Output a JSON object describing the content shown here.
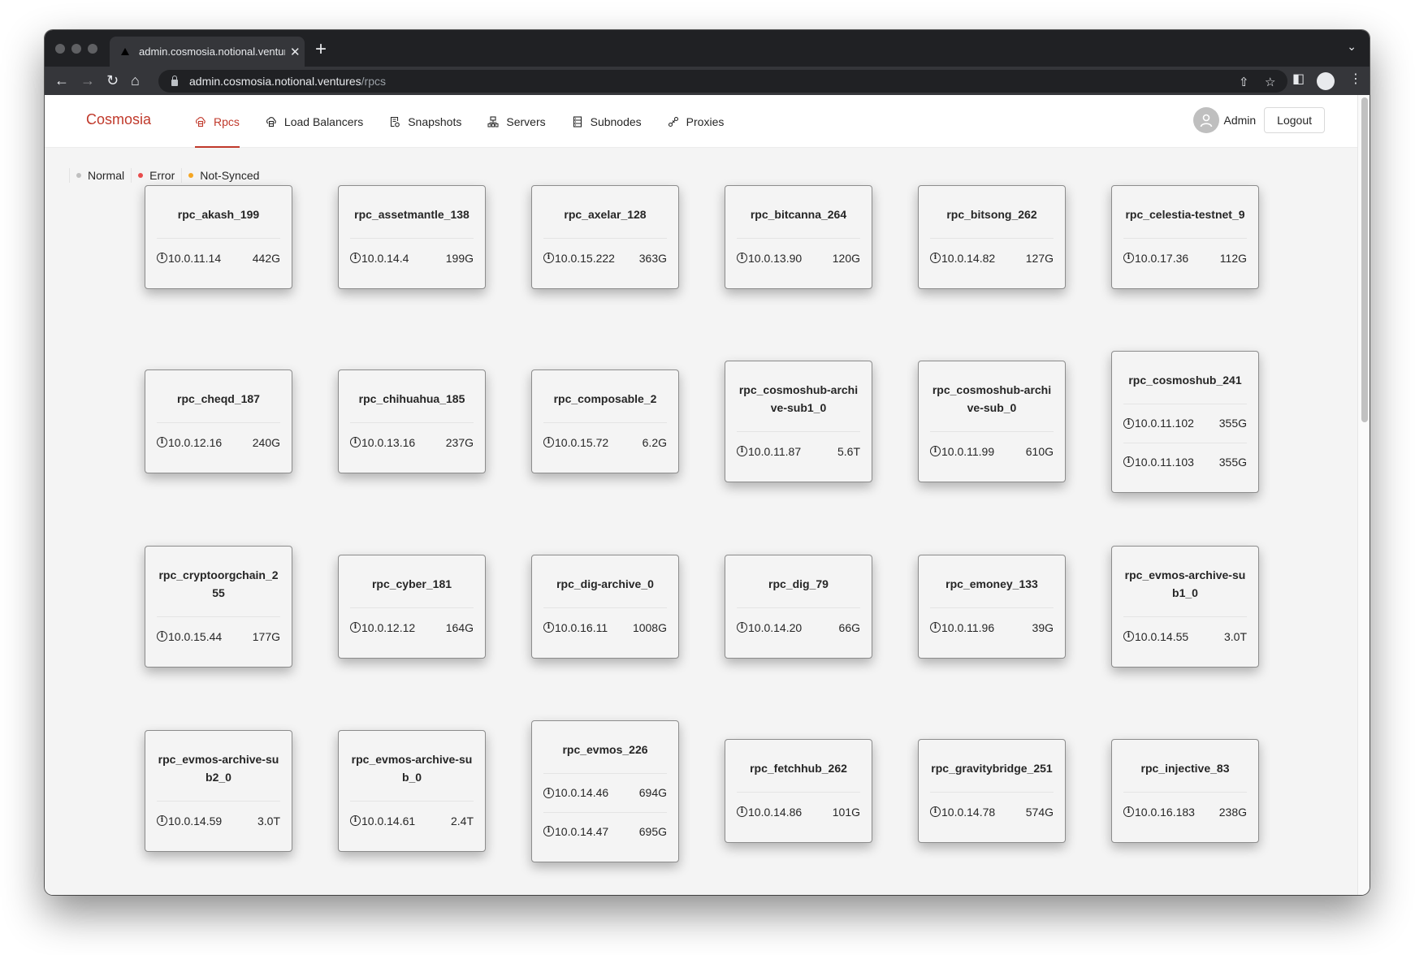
{
  "browser": {
    "tab_title": "admin.cosmosia.notional.ventures",
    "new_tab_label": "+",
    "url_host": "admin.cosmosia.notional.ventures",
    "url_path": "/rpcs"
  },
  "header": {
    "brand": "Cosmosia",
    "nav": [
      {
        "label": "Rpcs",
        "icon": "cloud-server-icon",
        "active": true
      },
      {
        "label": "Load Balancers",
        "icon": "cloud-server-icon",
        "active": false
      },
      {
        "label": "Snapshots",
        "icon": "file-sync-icon",
        "active": false
      },
      {
        "label": "Servers",
        "icon": "cluster-icon",
        "active": false
      },
      {
        "label": "Subnodes",
        "icon": "database-icon",
        "active": false
      },
      {
        "label": "Proxies",
        "icon": "link-icon",
        "active": false
      }
    ],
    "user_name": "Admin",
    "logout_label": "Logout"
  },
  "colors": {
    "accent": "#c0392b",
    "normal": "#bfbfbf",
    "error": "#e84c4c",
    "not_synced": "#f5a623"
  },
  "legend": [
    {
      "label": "Normal",
      "status": "normal"
    },
    {
      "label": "Error",
      "status": "error"
    },
    {
      "label": "Not-Synced",
      "status": "not_synced"
    }
  ],
  "rpcs": [
    {
      "name": "rpc_akash_199",
      "nodes": [
        {
          "ip": "10.0.11.14",
          "size": "442G"
        }
      ]
    },
    {
      "name": "rpc_assetmantle_138",
      "nodes": [
        {
          "ip": "10.0.14.4",
          "size": "199G"
        }
      ]
    },
    {
      "name": "rpc_axelar_128",
      "nodes": [
        {
          "ip": "10.0.15.222",
          "size": "363G"
        }
      ]
    },
    {
      "name": "rpc_bitcanna_264",
      "nodes": [
        {
          "ip": "10.0.13.90",
          "size": "120G"
        }
      ]
    },
    {
      "name": "rpc_bitsong_262",
      "nodes": [
        {
          "ip": "10.0.14.82",
          "size": "127G"
        }
      ]
    },
    {
      "name": "rpc_celestia-testnet_9",
      "nodes": [
        {
          "ip": "10.0.17.36",
          "size": "112G"
        }
      ]
    },
    {
      "name": "rpc_cheqd_187",
      "nodes": [
        {
          "ip": "10.0.12.16",
          "size": "240G"
        }
      ]
    },
    {
      "name": "rpc_chihuahua_185",
      "nodes": [
        {
          "ip": "10.0.13.16",
          "size": "237G"
        }
      ]
    },
    {
      "name": "rpc_composable_2",
      "nodes": [
        {
          "ip": "10.0.15.72",
          "size": "6.2G"
        }
      ]
    },
    {
      "name": "rpc_cosmoshub-archive-sub1_0",
      "nodes": [
        {
          "ip": "10.0.11.87",
          "size": "5.6T"
        }
      ]
    },
    {
      "name": "rpc_cosmoshub-archive-sub_0",
      "nodes": [
        {
          "ip": "10.0.11.99",
          "size": "610G"
        }
      ]
    },
    {
      "name": "rpc_cosmoshub_241",
      "nodes": [
        {
          "ip": "10.0.11.102",
          "size": "355G"
        },
        {
          "ip": "10.0.11.103",
          "size": "355G"
        }
      ]
    },
    {
      "name": "rpc_cryptoorgchain_255",
      "nodes": [
        {
          "ip": "10.0.15.44",
          "size": "177G"
        }
      ]
    },
    {
      "name": "rpc_cyber_181",
      "nodes": [
        {
          "ip": "10.0.12.12",
          "size": "164G"
        }
      ]
    },
    {
      "name": "rpc_dig-archive_0",
      "nodes": [
        {
          "ip": "10.0.16.11",
          "size": "1008G"
        }
      ]
    },
    {
      "name": "rpc_dig_79",
      "nodes": [
        {
          "ip": "10.0.14.20",
          "size": "66G"
        }
      ]
    },
    {
      "name": "rpc_emoney_133",
      "nodes": [
        {
          "ip": "10.0.11.96",
          "size": "39G"
        }
      ]
    },
    {
      "name": "rpc_evmos-archive-sub1_0",
      "nodes": [
        {
          "ip": "10.0.14.55",
          "size": "3.0T"
        }
      ]
    },
    {
      "name": "rpc_evmos-archive-sub2_0",
      "nodes": [
        {
          "ip": "10.0.14.59",
          "size": "3.0T"
        }
      ]
    },
    {
      "name": "rpc_evmos-archive-sub_0",
      "nodes": [
        {
          "ip": "10.0.14.61",
          "size": "2.4T"
        }
      ]
    },
    {
      "name": "rpc_evmos_226",
      "nodes": [
        {
          "ip": "10.0.14.46",
          "size": "694G"
        },
        {
          "ip": "10.0.14.47",
          "size": "695G"
        }
      ]
    },
    {
      "name": "rpc_fetchhub_262",
      "nodes": [
        {
          "ip": "10.0.14.86",
          "size": "101G"
        }
      ]
    },
    {
      "name": "rpc_gravitybridge_251",
      "nodes": [
        {
          "ip": "10.0.14.78",
          "size": "574G"
        }
      ]
    },
    {
      "name": "rpc_injective_83",
      "nodes": [
        {
          "ip": "10.0.16.183",
          "size": "238G"
        }
      ]
    }
  ]
}
